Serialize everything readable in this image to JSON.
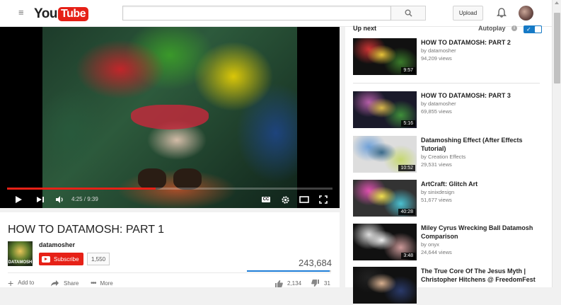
{
  "masthead": {
    "logo_you": "You",
    "logo_tube": "Tube",
    "search_placeholder": "",
    "upload_label": "Upload"
  },
  "player": {
    "time": "4:25 / 9:39",
    "progress_fraction": 0.457,
    "cc_label": "CC"
  },
  "video": {
    "title": "HOW TO DATAMOSH: PART 1",
    "channel": "datamosher",
    "channel_thumb_label": "DATAMOSH",
    "subscribe_label": "Subscribe",
    "subscriber_count": "1,550",
    "views": "243,684",
    "like_fraction": 0.986,
    "likes": "2,134",
    "dislikes": "31",
    "actions": {
      "add_to": "Add to",
      "share": "Share",
      "more": "More"
    }
  },
  "sidebar": {
    "up_next_label": "Up next",
    "autoplay_label": "Autoplay",
    "autoplay_on": true,
    "items": [
      {
        "title": "HOW TO DATAMOSH: PART 2",
        "channel": "by datamosher",
        "views": "94,209 views",
        "duration": "9:57",
        "colors": [
          "#c33",
          "#3a7a2a",
          "#e7c43a",
          "#111"
        ]
      },
      {
        "title": "HOW TO DATAMOSH: PART 3",
        "channel": "by datamosher",
        "views": "69,855 views",
        "duration": "5:16",
        "colors": [
          "#b55ea8",
          "#3f8f3a",
          "#d8b84a",
          "#1a1a2a"
        ]
      },
      {
        "title": "Datamoshing Effect (After Effects Tutorial)",
        "channel": "by Creation Effects",
        "views": "29,531 views",
        "duration": "10:52",
        "colors": [
          "#6ea0d8",
          "#c6d870",
          "#3a6a8a",
          "#ddd"
        ]
      },
      {
        "title": "ArtCraft: Glitch Art",
        "channel": "by sinixdesign",
        "views": "51,677 views",
        "duration": "40:28",
        "colors": [
          "#e050b0",
          "#4ac0d0",
          "#f0e050",
          "#333"
        ]
      },
      {
        "title": "Miley Cyrus Wrecking Ball Datamosh Comparison",
        "channel": "by onyx",
        "views": "24,644 views",
        "duration": "3:48",
        "colors": [
          "#ddd",
          "#c99",
          "#eee",
          "#111"
        ]
      },
      {
        "title": "The True Core Of The Jesus Myth | Christopher Hitchens @ FreedomFest",
        "channel": "",
        "views": "",
        "duration": "",
        "colors": [
          "#222",
          "#2a3a6a",
          "#d8b090",
          "#111"
        ]
      }
    ]
  }
}
